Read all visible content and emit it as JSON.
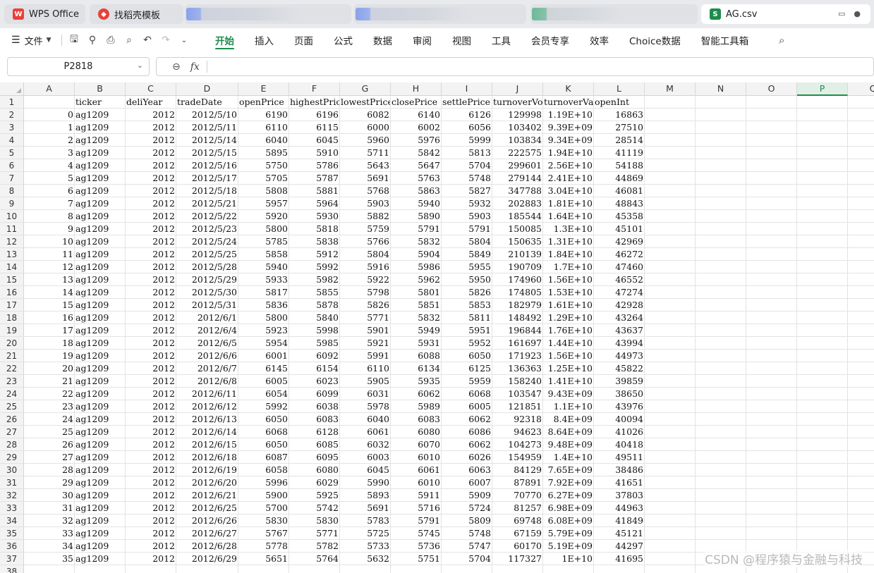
{
  "tabs": {
    "wps": {
      "label": "WPS Office",
      "icon": "wps-logo-icon"
    },
    "template": {
      "label": "找稻壳模板",
      "icon": "docer-logo-icon"
    },
    "active": {
      "label": "AG.csv",
      "icon": "sheet-logo-icon",
      "icon_text": "S"
    }
  },
  "ribbon": {
    "file_label": "文件",
    "menus": [
      "开始",
      "插入",
      "页面",
      "公式",
      "数据",
      "审阅",
      "视图",
      "工具",
      "会员专享",
      "效率",
      "Choice数据",
      "智能工具箱"
    ],
    "active_menu": "开始"
  },
  "formula_bar": {
    "name_box": "P2818",
    "fx_label": "fx",
    "formula": ""
  },
  "grid": {
    "columns": [
      "A",
      "B",
      "C",
      "D",
      "E",
      "F",
      "G",
      "H",
      "I",
      "J",
      "K",
      "L",
      "M",
      "N",
      "O",
      "P",
      "Q"
    ],
    "selected_column": "P",
    "row_numbers": [
      1,
      2,
      3,
      4,
      5,
      6,
      7,
      8,
      9,
      10,
      11,
      12,
      13,
      14,
      15,
      16,
      17,
      18,
      19,
      20,
      21,
      22,
      23,
      24,
      25,
      26,
      27,
      28,
      29,
      30,
      31,
      32,
      33,
      34,
      35,
      36,
      37,
      38
    ],
    "headers": [
      "",
      "ticker",
      "deliYear",
      "tradeDate",
      "openPrice",
      "highestPrice",
      "lowestPrice",
      "closePrice",
      "settlePrice",
      "turnoverVol",
      "turnoverValue",
      "openInt"
    ],
    "rows": [
      [
        "0",
        "ag1209",
        "2012",
        "2012/5/10",
        "6190",
        "6196",
        "6082",
        "6140",
        "6126",
        "129998",
        "1.19E+10",
        "16863"
      ],
      [
        "1",
        "ag1209",
        "2012",
        "2012/5/11",
        "6110",
        "6115",
        "6000",
        "6002",
        "6056",
        "103402",
        "9.39E+09",
        "27510"
      ],
      [
        "2",
        "ag1209",
        "2012",
        "2012/5/14",
        "6040",
        "6045",
        "5960",
        "5976",
        "5999",
        "103834",
        "9.34E+09",
        "28514"
      ],
      [
        "3",
        "ag1209",
        "2012",
        "2012/5/15",
        "5895",
        "5910",
        "5711",
        "5842",
        "5813",
        "222575",
        "1.94E+10",
        "41119"
      ],
      [
        "4",
        "ag1209",
        "2012",
        "2012/5/16",
        "5750",
        "5786",
        "5643",
        "5647",
        "5704",
        "299601",
        "2.56E+10",
        "54188"
      ],
      [
        "5",
        "ag1209",
        "2012",
        "2012/5/17",
        "5705",
        "5787",
        "5691",
        "5763",
        "5748",
        "279144",
        "2.41E+10",
        "44869"
      ],
      [
        "6",
        "ag1209",
        "2012",
        "2012/5/18",
        "5808",
        "5881",
        "5768",
        "5863",
        "5827",
        "347788",
        "3.04E+10",
        "46081"
      ],
      [
        "7",
        "ag1209",
        "2012",
        "2012/5/21",
        "5957",
        "5964",
        "5903",
        "5940",
        "5932",
        "202883",
        "1.81E+10",
        "48843"
      ],
      [
        "8",
        "ag1209",
        "2012",
        "2012/5/22",
        "5920",
        "5930",
        "5882",
        "5890",
        "5903",
        "185544",
        "1.64E+10",
        "45358"
      ],
      [
        "9",
        "ag1209",
        "2012",
        "2012/5/23",
        "5800",
        "5818",
        "5759",
        "5791",
        "5791",
        "150085",
        "1.3E+10",
        "45101"
      ],
      [
        "10",
        "ag1209",
        "2012",
        "2012/5/24",
        "5785",
        "5838",
        "5766",
        "5832",
        "5804",
        "150635",
        "1.31E+10",
        "42969"
      ],
      [
        "11",
        "ag1209",
        "2012",
        "2012/5/25",
        "5858",
        "5912",
        "5804",
        "5904",
        "5849",
        "210139",
        "1.84E+10",
        "46272"
      ],
      [
        "12",
        "ag1209",
        "2012",
        "2012/5/28",
        "5940",
        "5992",
        "5916",
        "5986",
        "5955",
        "190709",
        "1.7E+10",
        "47460"
      ],
      [
        "13",
        "ag1209",
        "2012",
        "2012/5/29",
        "5933",
        "5982",
        "5922",
        "5962",
        "5950",
        "174960",
        "1.56E+10",
        "46552"
      ],
      [
        "14",
        "ag1209",
        "2012",
        "2012/5/30",
        "5817",
        "5855",
        "5798",
        "5801",
        "5826",
        "174805",
        "1.53E+10",
        "47274"
      ],
      [
        "15",
        "ag1209",
        "2012",
        "2012/5/31",
        "5836",
        "5878",
        "5826",
        "5851",
        "5853",
        "182979",
        "1.61E+10",
        "42928"
      ],
      [
        "16",
        "ag1209",
        "2012",
        "2012/6/1",
        "5800",
        "5840",
        "5771",
        "5832",
        "5811",
        "148492",
        "1.29E+10",
        "43264"
      ],
      [
        "17",
        "ag1209",
        "2012",
        "2012/6/4",
        "5923",
        "5998",
        "5901",
        "5949",
        "5951",
        "196844",
        "1.76E+10",
        "43637"
      ],
      [
        "18",
        "ag1209",
        "2012",
        "2012/6/5",
        "5954",
        "5985",
        "5921",
        "5931",
        "5952",
        "161697",
        "1.44E+10",
        "43994"
      ],
      [
        "19",
        "ag1209",
        "2012",
        "2012/6/6",
        "6001",
        "6092",
        "5991",
        "6088",
        "6050",
        "171923",
        "1.56E+10",
        "44973"
      ],
      [
        "20",
        "ag1209",
        "2012",
        "2012/6/7",
        "6145",
        "6154",
        "6110",
        "6134",
        "6125",
        "136363",
        "1.25E+10",
        "45822"
      ],
      [
        "21",
        "ag1209",
        "2012",
        "2012/6/8",
        "6005",
        "6023",
        "5905",
        "5935",
        "5959",
        "158240",
        "1.41E+10",
        "39859"
      ],
      [
        "22",
        "ag1209",
        "2012",
        "2012/6/11",
        "6054",
        "6099",
        "6031",
        "6062",
        "6068",
        "103547",
        "9.43E+09",
        "38650"
      ],
      [
        "23",
        "ag1209",
        "2012",
        "2012/6/12",
        "5992",
        "6038",
        "5978",
        "5989",
        "6005",
        "121851",
        "1.1E+10",
        "43976"
      ],
      [
        "24",
        "ag1209",
        "2012",
        "2012/6/13",
        "6050",
        "6083",
        "6040",
        "6083",
        "6062",
        "92318",
        "8.4E+09",
        "40094"
      ],
      [
        "25",
        "ag1209",
        "2012",
        "2012/6/14",
        "6068",
        "6128",
        "6061",
        "6080",
        "6086",
        "94623",
        "8.64E+09",
        "41026"
      ],
      [
        "26",
        "ag1209",
        "2012",
        "2012/6/15",
        "6050",
        "6085",
        "6032",
        "6070",
        "6062",
        "104273",
        "9.48E+09",
        "40418"
      ],
      [
        "27",
        "ag1209",
        "2012",
        "2012/6/18",
        "6087",
        "6095",
        "6003",
        "6010",
        "6026",
        "154959",
        "1.4E+10",
        "49511"
      ],
      [
        "28",
        "ag1209",
        "2012",
        "2012/6/19",
        "6058",
        "6080",
        "6045",
        "6061",
        "6063",
        "84129",
        "7.65E+09",
        "38486"
      ],
      [
        "29",
        "ag1209",
        "2012",
        "2012/6/20",
        "5996",
        "6029",
        "5990",
        "6010",
        "6007",
        "87891",
        "7.92E+09",
        "41651"
      ],
      [
        "30",
        "ag1209",
        "2012",
        "2012/6/21",
        "5900",
        "5925",
        "5893",
        "5911",
        "5909",
        "70770",
        "6.27E+09",
        "37803"
      ],
      [
        "31",
        "ag1209",
        "2012",
        "2012/6/25",
        "5700",
        "5742",
        "5691",
        "5716",
        "5724",
        "81257",
        "6.98E+09",
        "44963"
      ],
      [
        "32",
        "ag1209",
        "2012",
        "2012/6/26",
        "5830",
        "5830",
        "5783",
        "5791",
        "5809",
        "69748",
        "6.08E+09",
        "41849"
      ],
      [
        "33",
        "ag1209",
        "2012",
        "2012/6/27",
        "5767",
        "5771",
        "5725",
        "5745",
        "5748",
        "67159",
        "5.79E+09",
        "45121"
      ],
      [
        "34",
        "ag1209",
        "2012",
        "2012/6/28",
        "5778",
        "5782",
        "5733",
        "5736",
        "5747",
        "60170",
        "5.19E+09",
        "44297"
      ],
      [
        "35",
        "ag1209",
        "2012",
        "2012/6/29",
        "5651",
        "5764",
        "5632",
        "5751",
        "5704",
        "117327",
        "1E+10",
        "41695"
      ]
    ]
  },
  "watermark": "CSDN @程序猿与金融与科技",
  "colors": {
    "accent": "#1e8b4c",
    "wps_red": "#e8403a"
  }
}
